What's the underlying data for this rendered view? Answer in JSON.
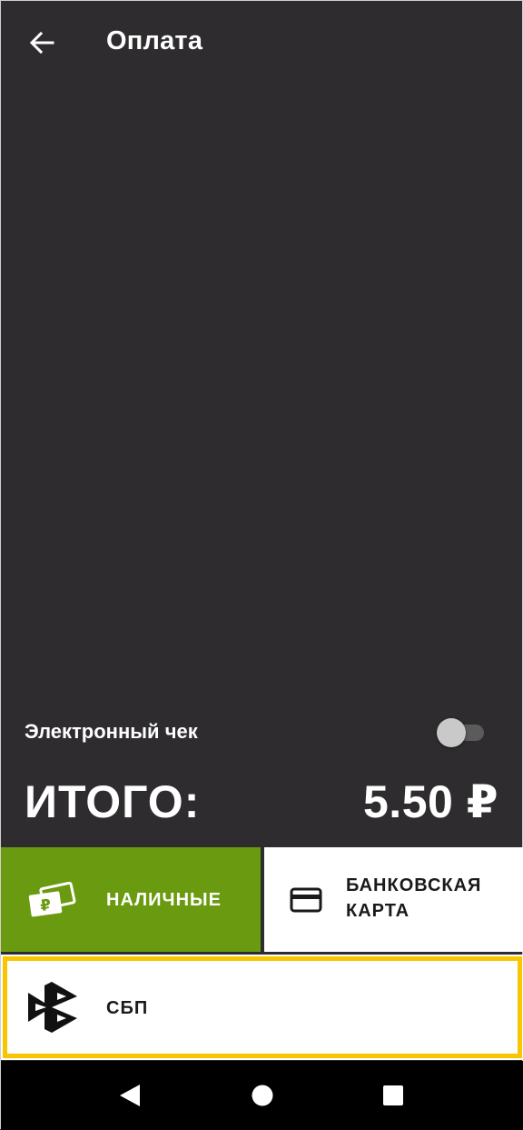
{
  "header": {
    "title": "Оплата",
    "back_icon": "arrow-left-icon"
  },
  "electronic_receipt": {
    "label": "Электронный чек",
    "enabled": false
  },
  "total": {
    "label": "ИТОГО:",
    "amount": "5.50 ₽"
  },
  "payment_methods": {
    "cash": {
      "label": "НАЛИЧНЫЕ",
      "icon": "banknotes-ruble-icon",
      "color": "#6a9a0f"
    },
    "card": {
      "label_line1": "БАНКОВСКАЯ",
      "label_line2": "КАРТА",
      "icon": "credit-card-icon"
    },
    "sbp": {
      "label": "СБП",
      "icon": "sbp-logo-icon",
      "selected": true,
      "highlight_color": "#f7c600"
    }
  },
  "navigation_bar": {
    "back_icon": "nav-back-triangle-icon",
    "home_icon": "nav-home-circle-icon",
    "recents_icon": "nav-recents-square-icon"
  },
  "colors": {
    "background": "#2e2c2f",
    "nav_background": "#000000"
  }
}
